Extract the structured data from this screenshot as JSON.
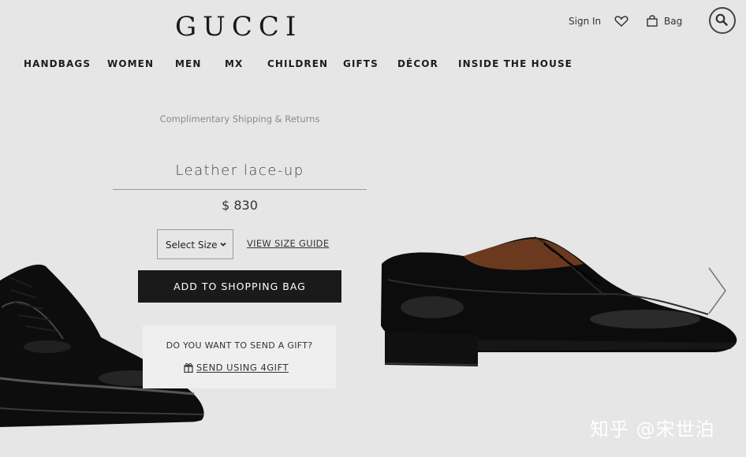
{
  "brand": {
    "logo_text": "GUCCI"
  },
  "utility": {
    "sign_in": "Sign In",
    "wishlist_icon": "heart-icon",
    "bag_icon": "shopping-bag-icon",
    "bag": "Bag",
    "search_icon": "search-icon"
  },
  "nav": {
    "items": [
      {
        "label": "HANDBAGS"
      },
      {
        "label": "WOMEN"
      },
      {
        "label": "MEN"
      },
      {
        "label": "MX"
      },
      {
        "label": "CHILDREN"
      },
      {
        "label": "GIFTS"
      },
      {
        "label": "DÉCOR"
      },
      {
        "label": "INSIDE THE HOUSE"
      }
    ]
  },
  "product": {
    "shipping_note": "Complimentary Shipping & Returns",
    "title": "Leather lace-up",
    "price": "$ 830",
    "size_select": {
      "value": "Select Size"
    },
    "size_guide": "VIEW SIZE GUIDE",
    "add_to_bag": "ADD TO SHOPPING BAG"
  },
  "gift": {
    "question": "DO YOU WANT TO SEND A GIFT?",
    "link_icon": "gift-icon",
    "link": "SEND USING 4GIFT"
  },
  "carousel": {
    "next_icon": "chevron-right-icon"
  },
  "watermark": "知乎 @宋世泊",
  "colors": {
    "background": "#e6e6e6",
    "button": "#1a1a1a",
    "button_text": "#ffffff"
  }
}
